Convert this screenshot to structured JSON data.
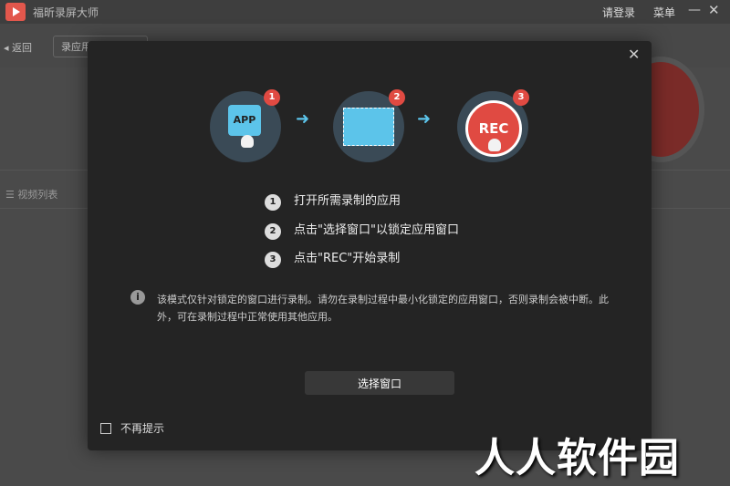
{
  "window": {
    "title": "福昕录屏大师",
    "login": "请登录",
    "menu": "菜单",
    "minimize": "—",
    "close": "✕"
  },
  "toolbar": {
    "back": "◂ 返回",
    "tab": "录应用"
  },
  "list": {
    "label": "☰ 视频列表"
  },
  "dialog": {
    "close": "✕",
    "steps": [
      {
        "num": "1",
        "text": "打开所需录制的应用"
      },
      {
        "num": "2",
        "text": "点击\"选择窗口\"以锁定应用窗口"
      },
      {
        "num": "3",
        "text": "点击\"REC\"开始录制"
      }
    ],
    "illustration": {
      "app_label": "APP",
      "rec_label": "REC",
      "badges": [
        "1",
        "2",
        "3"
      ]
    },
    "info": "i",
    "note": "该模式仅针对锁定的窗口进行录制。请勿在录制过程中最小化锁定的应用窗口，否则录制会被中断。此外，可在录制过程中正常使用其他应用。",
    "choose_button": "选择窗口",
    "dont_show": "不再提示"
  },
  "watermark": "人人软件园",
  "colors": {
    "accent": "#5cc4ea",
    "rec": "#e04a42",
    "dialog_bg": "#242424"
  }
}
